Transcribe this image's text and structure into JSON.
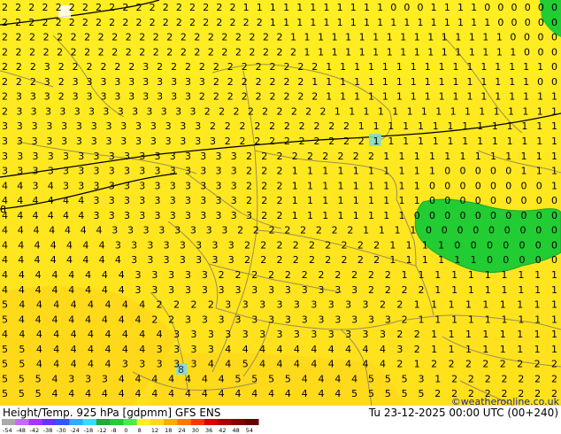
{
  "map": {
    "title": "Height/Temp. 925 hPa [gdpmm] GFS ENS",
    "datetime": "Tu 23-12-2025 00:00 UTC (00+240)",
    "credit": "©weatheronline.co.uk",
    "marker_label": "8",
    "left_edge_label": "8",
    "colors": {
      "yellow": "#ffee22",
      "orange_yellow": "#ffd81a",
      "green": "#22cc33",
      "border": "#9a8f52",
      "contour": "#000000"
    },
    "legend": {
      "ticks": [
        "-54",
        "-48",
        "-42",
        "-38",
        "-30",
        "-24",
        "-18",
        "-12",
        "-8",
        "0",
        "8",
        "12",
        "18",
        "24",
        "30",
        "36",
        "42",
        "48",
        "54"
      ],
      "colors": [
        "#aaaaaa",
        "#cc66ff",
        "#aa33ff",
        "#6633ff",
        "#3355ff",
        "#33aaff",
        "#33ddff",
        "#22aa33",
        "#22cc33",
        "#44ee44",
        "#ffee22",
        "#ffd81a",
        "#ffaa00",
        "#ff7700",
        "#ff3300",
        "#dd0000",
        "#aa0000",
        "#880000",
        "#660000"
      ]
    },
    "grid_rows": [
      "2 2 2 2 2 2 2 2 2 2 2 2 2 2 2 2 2 2 1 1 1 1 1 1 1 1 1 1 1 0 0 0 1 1 1 1 0 0 0 0 0 0",
      "2 2 2 2 2 2 2 2 2 2 2 2 2 2 2 2 2 2 2 2 1 1 1 1 1 1 1 1 1 1 1 1 1 1 1 1 1 0 0 0 0 0",
      "2 2 2 2 2 2 2 2 2 2 2 2 2 2 2 2 2 2 2 2 2 1 1 1 1 1 1 1 1 1 1 1 1 1 1 1 1 0 0 0 0",
      "2 2 2 2 2 2 2 2 2 2 2 2 2 2 2 2 2 2 2 2 2 2 1 1 1 1 1 1 1 1 1 1 1 1 1 1 1 1 0 0 0",
      "2 2 2 3 2 2 2 2 2 2 3 2 2 2 2 2 2 2 2 2 2 2 2 1 1 1 1 1 1 1 1 1 1 1 1 1 1 1 1 0",
      "2 2 2 3 2 3 3 3 3 3 3 3 3 3 3 2 2 2 2 2 2 2 1 1 1 1 1 1 1 1 1 1 1 1 1 1 1 1 0 0",
      "2 3 3 3 2 3 3 3 3 3 3 3 3 3 2 2 2 2 2 2 2 2 2 1 1 1 1 1 1 1 1 1 1 1 1 1 1 1 1 1",
      "2 3 3 3 3 3 3 3 3 3 3 3 3 3 2 2 2 2 2 2 2 2 2 1 1 1 1 1 1 1 1 1 1 1 1 1 1 1 1",
      "3 3 3 3 3 3 3 3 3 3 3 3 3 3 2 2 2 2 2 2 2 2 2 2 1 1 1 1 1 1 1 1 1 1 1 1 1 1",
      "3 3 3 3 3 3 3 3 3 3 3 3 3 3 3 2 2 2 2 2 2 2 2 2 2 1 1 1 1 1 1 1 1 1 1 1 1 1",
      "3 3 3 3 3 3 3 3 3 3 3 3 3 3 3 3 2 2 2 2 2 2 2 2 2 1 1 1 1 1 1 1 1 1 1 1 1",
      "3 3 3 3 3 3 3 3 3 3 3 3 3 3 3 3 2 2 2 1 1 1 1 1 1 1 1 1 1 0 0 0 0 0 1 1 1",
      "4 4 3 4 3 3 3 3 3 3 3 3 3 3 3 3 2 2 2 1 1 1 1 1 1 1 1 1 0 0 0 0 0 0 0 0 1",
      "4 4 4 4 4 4 3 3 3 3 3 3 3 3 3 3 2 2 2 1 1 1 1 1 1 1 1 1 0 0 0 0 0 0 0 0 0",
      "4 4 4 4 4 4 3 3 3 3 3 3 3 3 3 3 3 2 2 1 1 1 1 1 1 1 1 0 0 0 0 0 0 0 0 0 0",
      "4 4 4 4 4 4 4 3 3 3 3 3 3 3 3 2 2 2 2 2 2 2 2 1 1 1 1 0 0 0 0 0 0 0 0 0",
      "4 4 4 4 4 4 4 3 3 3 3 3 3 3 3 2 2 2 2 2 2 2 2 2 1 1 1 1 0 0 0 0 0 0 0",
      "4 4 4 4 4 4 4 4 3 3 3 3 3 3 3 2 2 2 2 2 2 2 2 2 1 1 1 1 1 1 0 0 0 0 0",
      "4 4 4 4 4 4 4 4 3 3 3 3 3 2 2 2 2 2 2 2 2 2 2 2 1 1 1 1 1 1 1 1 1 1",
      "4 4 4 4 4 4 4 4 3 3 3 3 3 3 3 3 3 3 3 3 3 3 2 2 2 2 1 1 1 1 1 1 1 1",
      "5 4 4 4 4 4 4 4 4 2 2 2 2 3 3 3 3 3 3 3 3 3 2 2 1 1 1 1 1 1 1 1 1",
      "5 4 4 4 4 4 4 4 4 2 2 3 3 3 3 3 3 3 3 3 3 3 3 3 2 1 1 1 1 1 1 1 1 1",
      "4 4 4 4 4 4 4 4 4 4 3 3 3 3 3 3 3 3 3 3 3 3 3 2 2 1 1 1 1 1 1 1 1",
      "5 5 4 4 4 4 4 4 4 3 3 3 3 4 4 4 4 4 4 4 4 4 4 3 2 1 1 1 1 1 1 1 1",
      "5 5 4 4 4 4 4 3 3 3 3 3 4 4 5 4 4 4 4 4 4 4 4 2 1 2 2 2 2 2 2 2 2",
      "5 5 5 4 3 3 3 4 4 4 4 4 4 4 5 5 5 5 4 4 4 4 5 5 5 3 1 2 2 2 2 2 2 2",
      "5 5 5 4 4 4 4 4 4 4 4 4 4 4 4 4 4 4 4 4 4 5 5 5 5 5 2 2 2 2 2 2 2 2"
    ]
  }
}
